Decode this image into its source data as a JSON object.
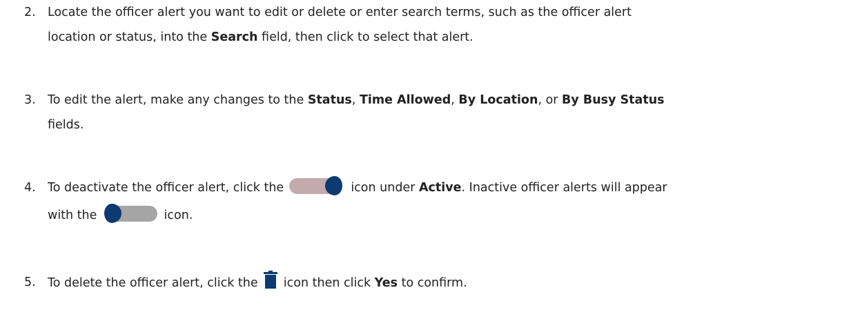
{
  "steps": [
    {
      "number": "2.",
      "line1_a": "Locate the officer alert you want to edit or delete or enter search terms, such as the officer alert",
      "line2_a": "location or status, into the ",
      "line2_bold": "Search",
      "line2_b": " field, then click to select that alert."
    },
    {
      "number": "3.",
      "a": "To edit the alert, make any changes to the ",
      "b1": "Status",
      "s1": ", ",
      "b2": "Time Allowed",
      "s2": ", ",
      "b3": "By Location",
      "s3": ", or ",
      "b4": "By Busy Status",
      "line2": "fields."
    },
    {
      "number": "4.",
      "a": "To deactivate the officer alert, click the ",
      "b": " icon under ",
      "bold": "Active",
      "c": ". Inactive officer alerts will appear",
      "line2_a": "with the ",
      "line2_b": " icon."
    },
    {
      "number": "5.",
      "a": "To delete the officer alert, click the ",
      "b": " icon then click ",
      "bold": "Yes",
      "c": " to confirm."
    }
  ],
  "icons": {
    "active_toggle": "toggle-on-icon",
    "inactive_toggle": "toggle-off-icon",
    "delete": "trash-icon"
  },
  "colors": {
    "text": "#222222",
    "toggle_knob": "#0b3b70",
    "toggle_on_track": "#c2aaad",
    "toggle_off_track": "#a5a5a5",
    "trash": "#0b3b70"
  }
}
